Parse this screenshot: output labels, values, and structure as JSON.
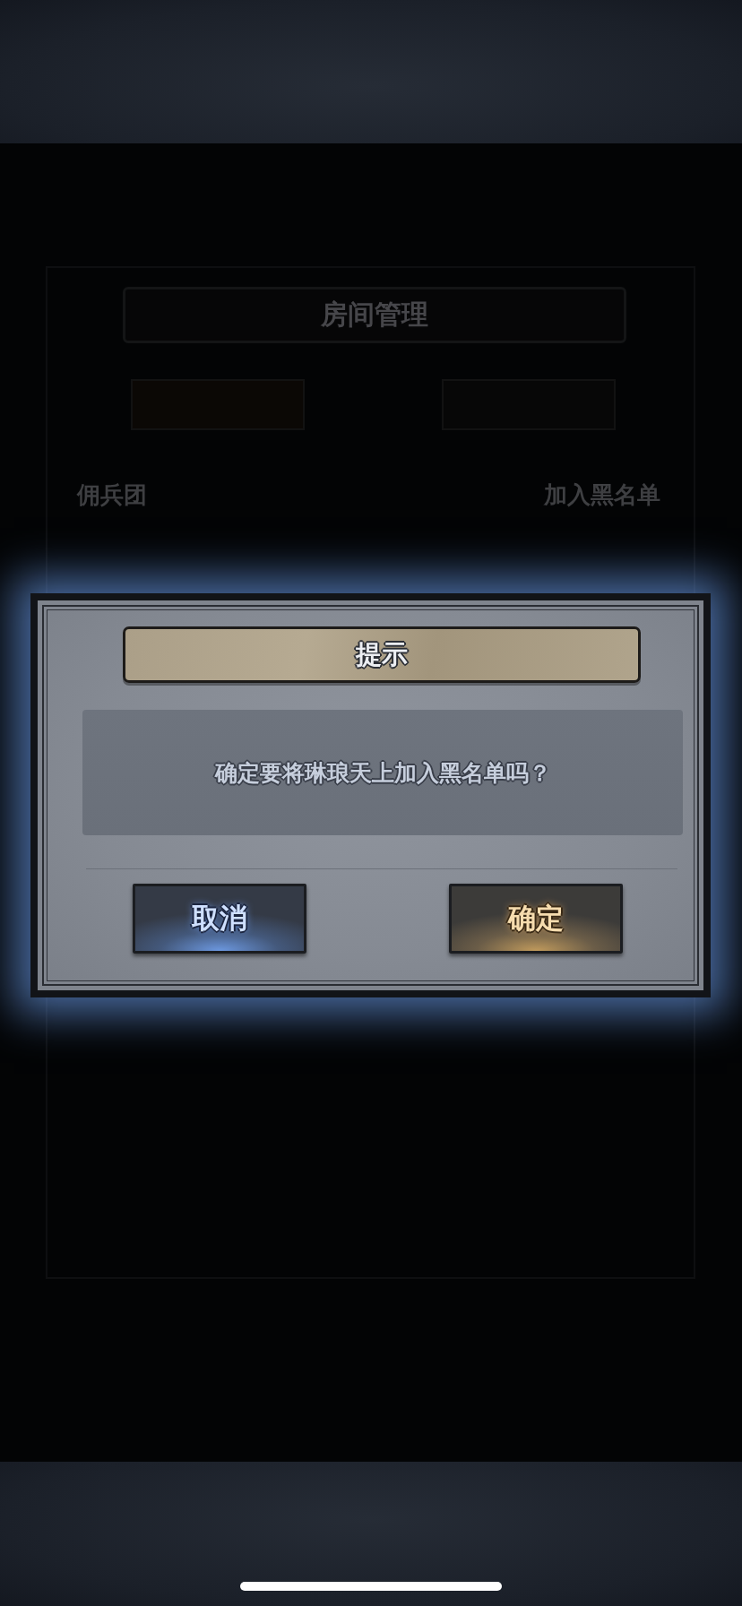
{
  "background": {
    "title": "房间管理",
    "labels": [
      "佣兵团",
      "加入黑名单"
    ]
  },
  "dialog": {
    "title": "提示",
    "message": "确定要将琳琅天上加入黑名单吗？",
    "buttons": [
      {
        "label": "取消",
        "kind": "cancel"
      },
      {
        "label": "确定",
        "kind": "confirm"
      }
    ]
  }
}
